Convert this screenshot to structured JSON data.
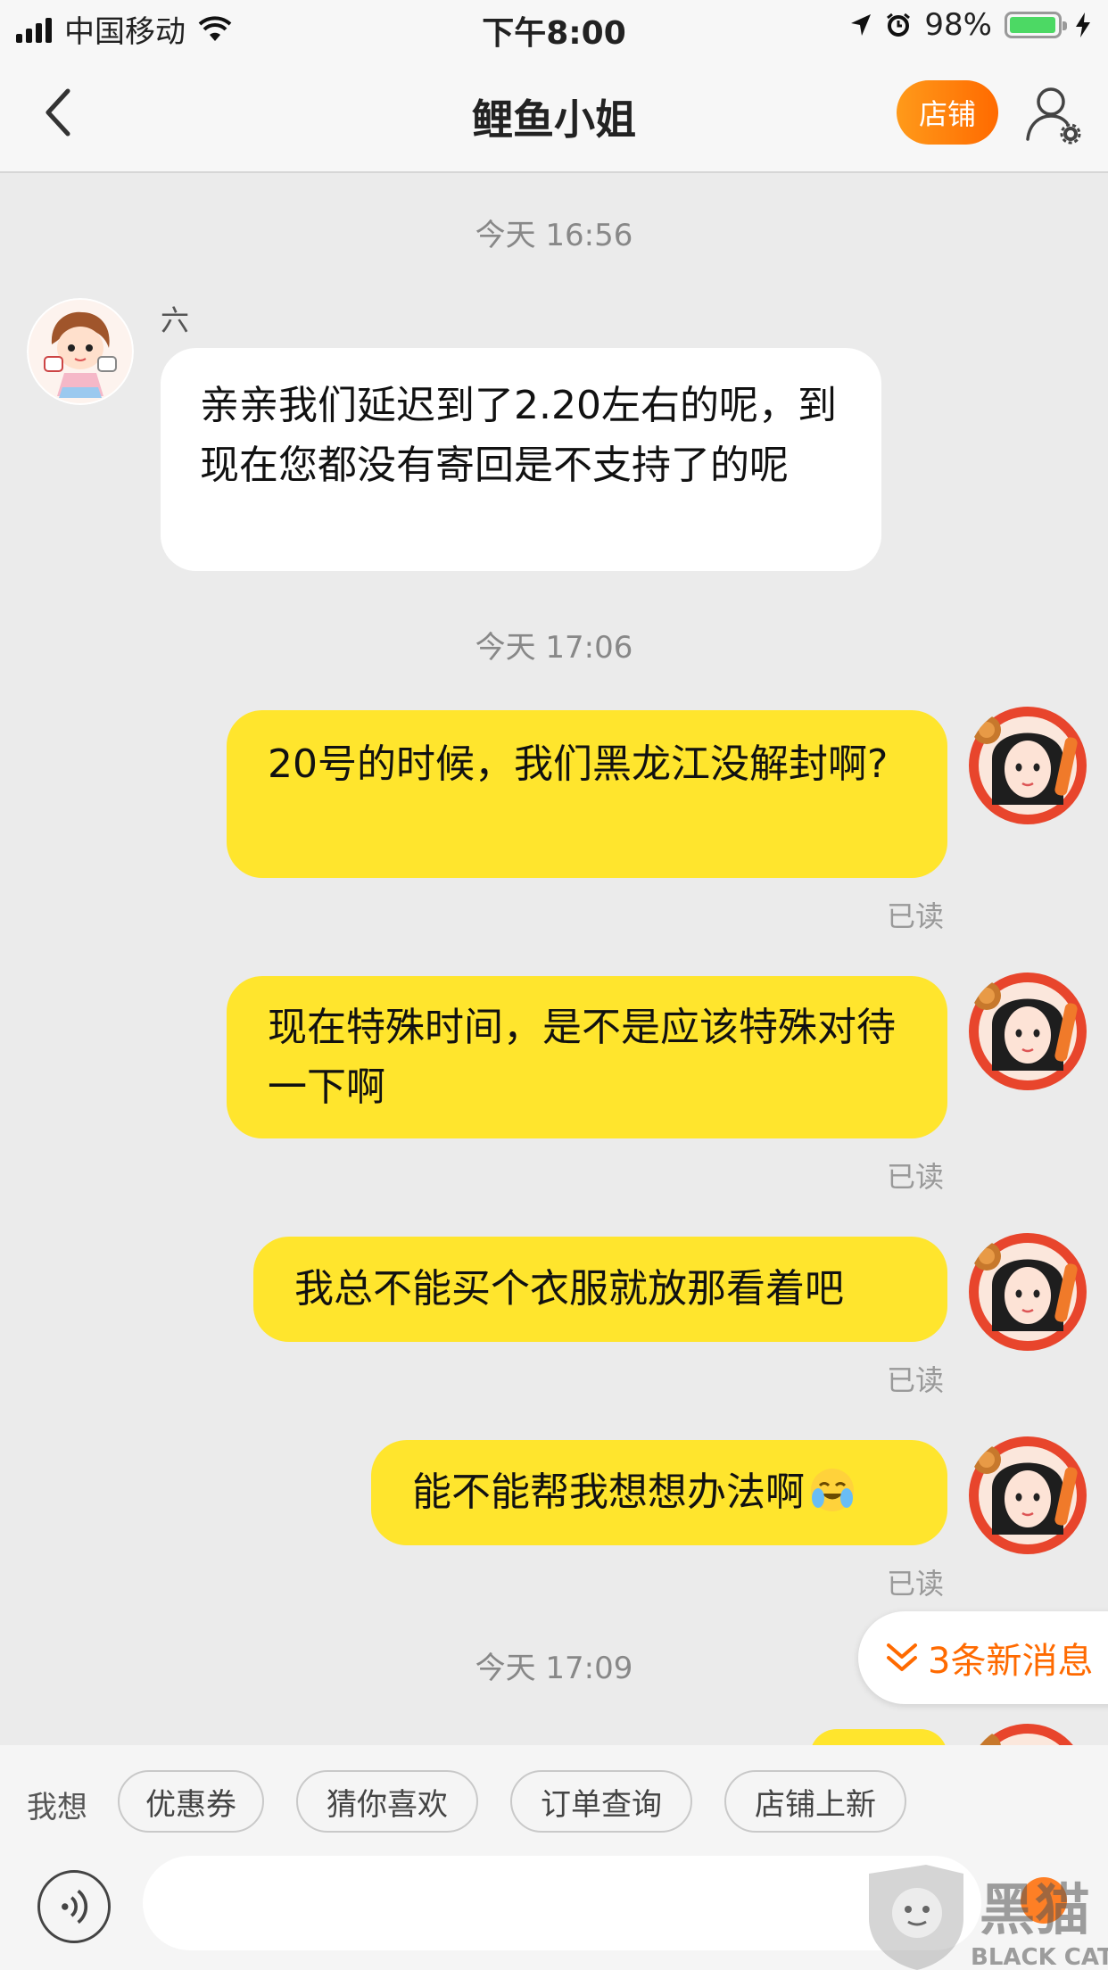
{
  "status_bar": {
    "carrier": "中国移动",
    "time": "下午8:00",
    "battery": "98%",
    "battery_level": 0.98
  },
  "nav": {
    "title": "鲤鱼小姐",
    "store_label": "店铺"
  },
  "chat": {
    "timestamps": [
      "今天 16:56",
      "今天 17:06",
      "今天 17:09"
    ],
    "incoming_sender": "六",
    "incoming_message": "亲亲我们延迟到了2.20左右的呢，到现在您都没有寄回是不支持了的呢",
    "outgoing": [
      {
        "text": "20号的时候，我们黑龙江没解封啊?",
        "status": "已读"
      },
      {
        "text": "现在特殊时间，是不是应该特殊对待一下啊",
        "status": "已读"
      },
      {
        "text": "我总不能买个衣服就放那看着吧",
        "status": "已读"
      },
      {
        "text": "能不能帮我想想办法啊",
        "emoji": "crying-laughing-emoji",
        "status": "已读"
      }
    ],
    "new_messages": "3条新消息"
  },
  "quick_replies": {
    "label": "我想",
    "chips": [
      "优惠券",
      "猜你喜欢",
      "订单查询",
      "店铺上新"
    ]
  },
  "input": {
    "placeholder": ""
  },
  "watermark": {
    "text": "黑猫",
    "subtext": "BLACK CAT"
  },
  "colors": {
    "accent": "#ff6a00",
    "bubble_outgoing": "#ffe52d",
    "bubble_incoming": "#ffffff",
    "background": "#ebebeb"
  }
}
